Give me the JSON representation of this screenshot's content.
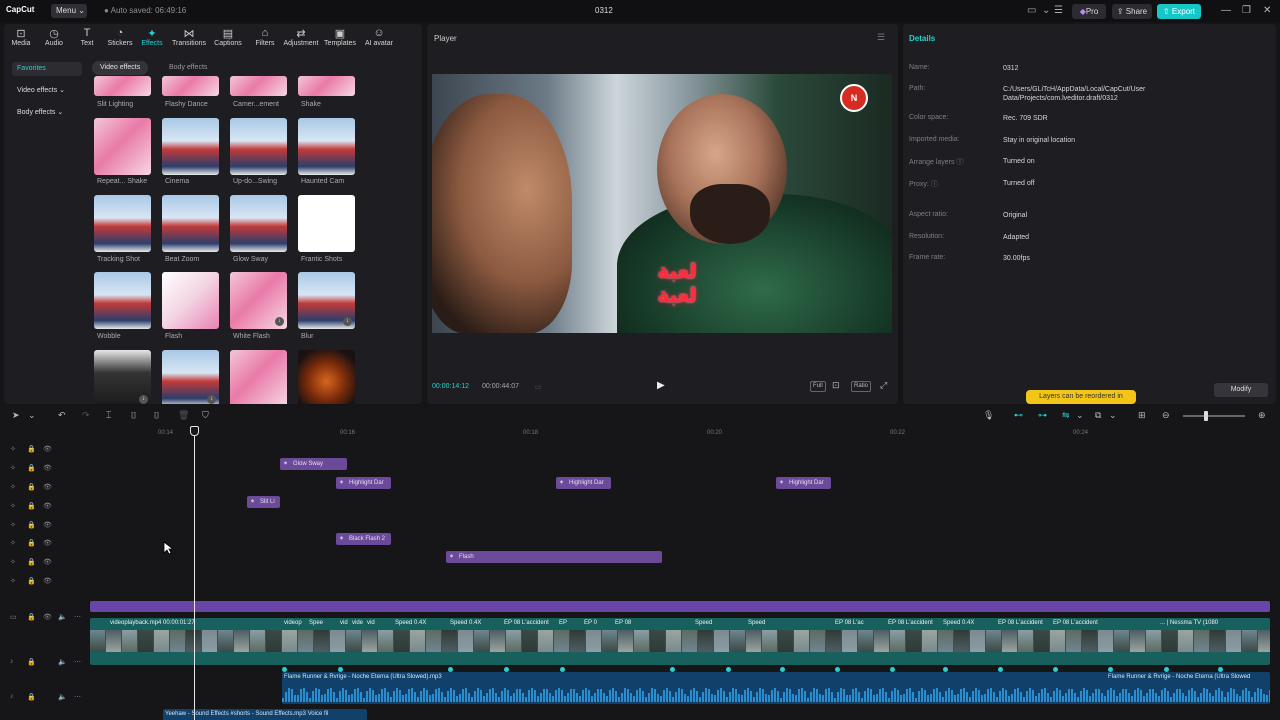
{
  "app": {
    "name": "CapCut",
    "menu_label": "Menu",
    "autosave": "Auto saved: 06:49:16",
    "project_title": "0312",
    "pro_label": "Pro",
    "share_label": "Share",
    "export_label": "Export",
    "colors": {
      "accent": "#25d1d1",
      "export": "#17c7c7",
      "fx_clip": "#6b4a9a",
      "video_track": "#17605e",
      "audio_track": "#11406a"
    }
  },
  "toolbar": {
    "tabs": [
      {
        "label": "Media",
        "icon": "media-icon"
      },
      {
        "label": "Audio",
        "icon": "audio-icon"
      },
      {
        "label": "Text",
        "icon": "text-icon"
      },
      {
        "label": "Stickers",
        "icon": "stickers-icon"
      },
      {
        "label": "Effects",
        "icon": "effects-icon",
        "active": true
      },
      {
        "label": "Transitions",
        "icon": "transitions-icon"
      },
      {
        "label": "Captions",
        "icon": "captions-icon"
      },
      {
        "label": "Filters",
        "icon": "filters-icon"
      },
      {
        "label": "Adjustment",
        "icon": "adjustment-icon"
      },
      {
        "label": "Templates",
        "icon": "templates-icon"
      },
      {
        "label": "AI avatar",
        "icon": "ai-avatar-icon"
      }
    ]
  },
  "effects_panel": {
    "sidebar": [
      "Favorites",
      "Video effects",
      "Body effects"
    ],
    "chips": [
      "Video effects",
      "Body effects"
    ],
    "top_row": [
      "Slit Lighting",
      "Flashy Dance",
      "Camer...ement",
      "Shake"
    ],
    "rows": [
      [
        "Repeat... Shake",
        "Cinema",
        "Up-do...Swing",
        "Haunted Cam"
      ],
      [
        "Tracking Shot",
        "Beat Zoom",
        "Glow Sway",
        "Frantic Shots"
      ],
      [
        "Wobble",
        "Flash",
        "White Flash",
        "Blur"
      ]
    ]
  },
  "player": {
    "title": "Player",
    "caption_line1": "لعبة",
    "caption_line2": "لعبة",
    "timecode_current": "00:00:14:12",
    "timecode_total": "00:00:44:07",
    "full_label": "Full",
    "ratio_label": "Ratio"
  },
  "details": {
    "title": "Details",
    "fields": [
      {
        "key": "Name:",
        "value": "0312"
      },
      {
        "key": "Path:",
        "value": "C:/Users/GLiTcH/AppData/Local/CapCut/User Data/Projects/com.lveditor.draft/0312"
      },
      {
        "key": "Color space:",
        "value": "Rec. 709 SDR"
      },
      {
        "key": "Imported media:",
        "value": "Stay in original location"
      },
      {
        "key": "Arrange layers",
        "value": "Turned on"
      },
      {
        "key": "Proxy:",
        "value": "Turned off"
      },
      {
        "key": "Aspect ratio:",
        "value": "Original"
      },
      {
        "key": "Resolution:",
        "value": "Adapted"
      },
      {
        "key": "Frame rate:",
        "value": "30.00fps"
      }
    ],
    "tip": "Layers can be reordered in",
    "modify_label": "Modify"
  },
  "timeline": {
    "ruler": [
      "00:14",
      "00:16",
      "00:18",
      "00:20",
      "00:22",
      "00:24"
    ],
    "fx_clips": [
      {
        "label": "Glow Sway"
      },
      {
        "label": "Highlight Dar"
      },
      {
        "label": "Highlight Dar"
      },
      {
        "label": "Highlight Dar"
      },
      {
        "label": "Slit Li"
      },
      {
        "label": "Black Flash 2"
      },
      {
        "label": "Flash"
      }
    ],
    "video_clips": [
      "videoplayback.mp4   00:00:01:27",
      "videop",
      "Spee",
      "vid",
      "vide",
      "vid",
      "Speed 0.4X",
      "Speed 0.4X",
      "EP 08 L'accident",
      "EP",
      "EP 0",
      "EP 08",
      "Speed",
      "Speed",
      "EP 08 L'ac",
      "EP 08 L'accident",
      "Speed 0.4X",
      "EP 08 L'accident",
      "EP 08 L'accident",
      "... | Nessma TV (1080"
    ],
    "audio1_left": "Flame Runner & Rvrige - Noche Eterna (Ultra Slowed).mp3",
    "audio1_right": "Flame Runner & Rvrige - Noche Eterna (Ultra Slowed",
    "audio2": "Yeehaw - Sound Effects   #shorts - Sound Effects.mp3   Voice fil"
  }
}
